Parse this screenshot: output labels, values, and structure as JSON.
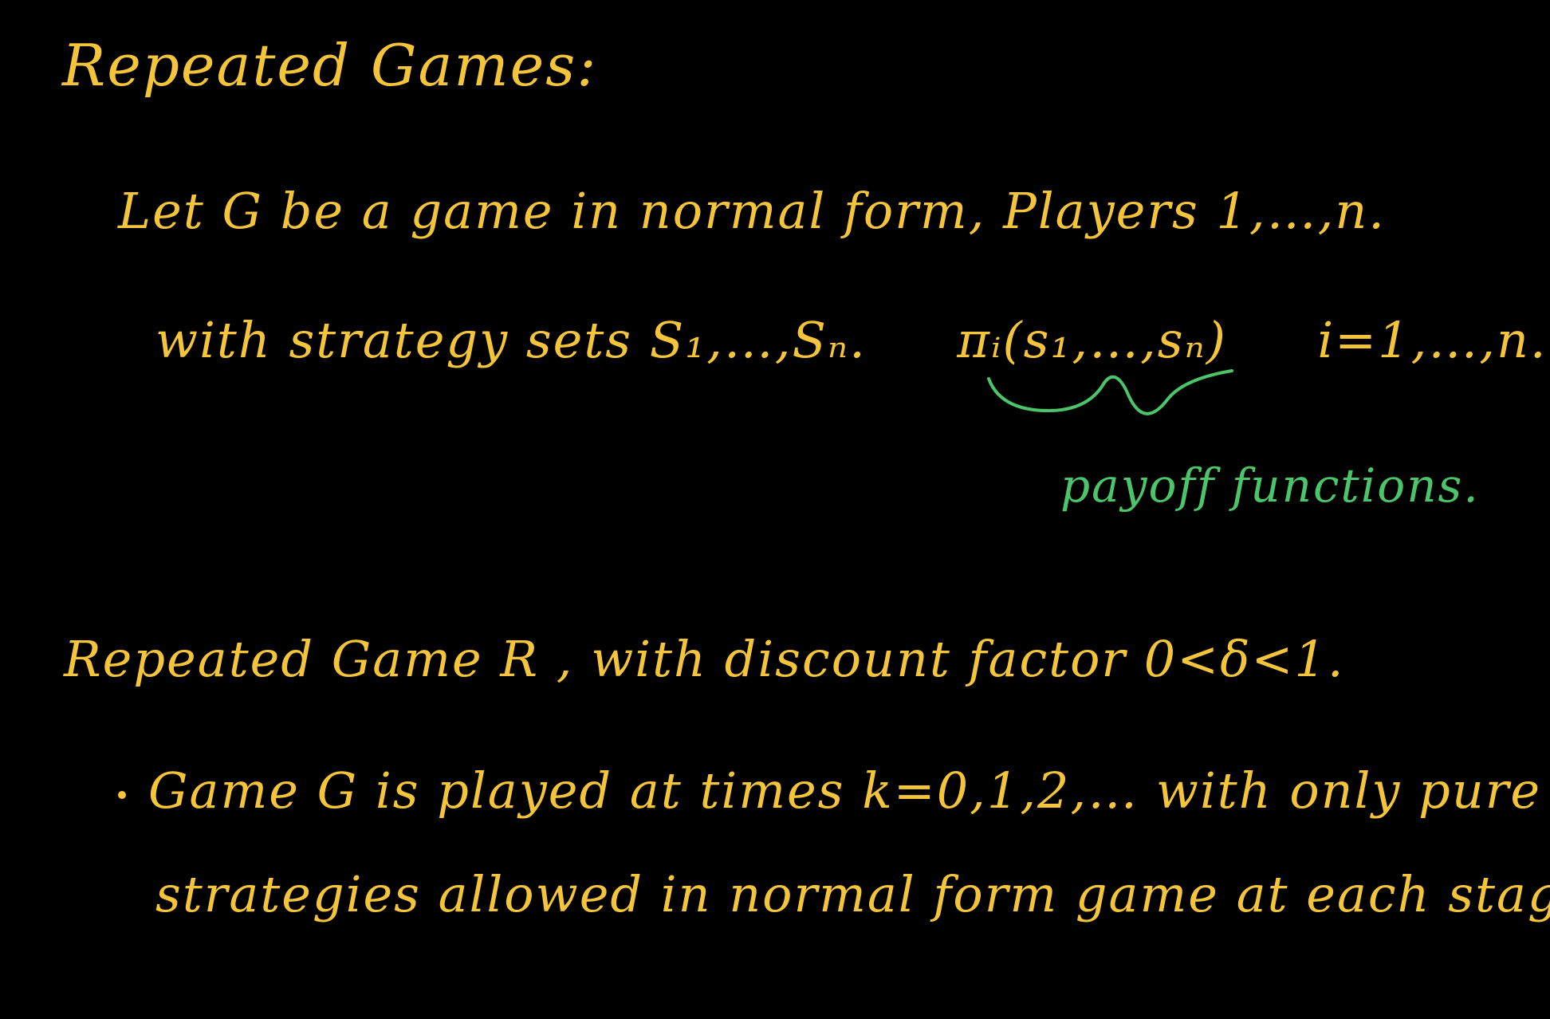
{
  "title": "Repeated Games:",
  "lines": {
    "line1": "Let G be a game in normal form, Players 1,…,n.",
    "line2_a": "with strategy sets S₁,…,Sₙ.",
    "line2_b": "πᵢ(s₁,…,sₙ)",
    "line2_c": "i=1,…,n.",
    "line3": "Repeated Game R , with discount factor 0<δ<1.",
    "line4": "Game G is played at times k=0,1,2,… with only pure",
    "line5": "strategies allowed in normal form game at each stage."
  },
  "annotation": {
    "label": "payoff functions."
  },
  "colors": {
    "background": "#000000",
    "main_ink": "#f4c43a",
    "annotation_ink": "#4cc46a"
  }
}
